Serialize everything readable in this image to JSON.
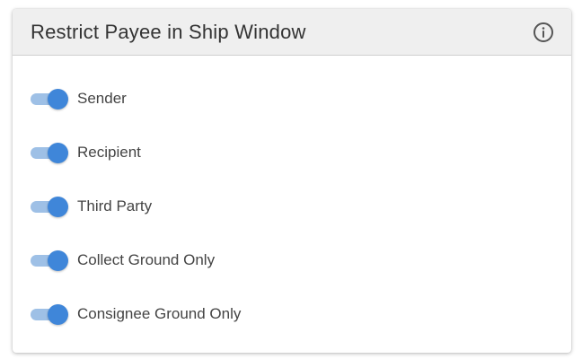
{
  "card": {
    "title": "Restrict Payee in Ship Window",
    "info_icon": "info-circle-icon"
  },
  "toggles": [
    {
      "label": "Sender",
      "checked": true
    },
    {
      "label": "Recipient",
      "checked": true
    },
    {
      "label": "Third Party",
      "checked": true
    },
    {
      "label": "Collect Ground Only",
      "checked": true
    },
    {
      "label": "Consignee Ground Only",
      "checked": true
    }
  ],
  "colors": {
    "accent": "#3f86d9",
    "track_on": "#9ec0e6",
    "header_bg": "#efefef"
  }
}
